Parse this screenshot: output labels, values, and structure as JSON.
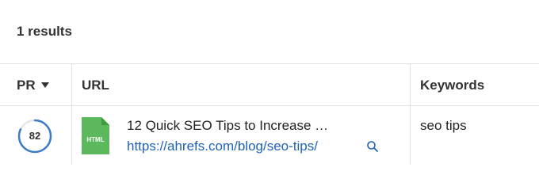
{
  "results": {
    "count_label": "1 results"
  },
  "table": {
    "columns": {
      "pr": "PR",
      "url": "URL",
      "keywords": "Keywords"
    },
    "rows": [
      {
        "pr": "82",
        "pr_fraction": 0.82,
        "file_type": "HTML",
        "title": "12 Quick SEO Tips to Increase …",
        "url": "https://ahrefs.com/blog/seo-tips/",
        "keywords": "seo tips"
      }
    ]
  },
  "colors": {
    "link": "#1f63b8",
    "pr_ring": "#3c7cc4",
    "file_icon": "#5cb85c"
  },
  "icons": [
    "sort-desc-icon",
    "html-file-icon",
    "search-icon"
  ]
}
